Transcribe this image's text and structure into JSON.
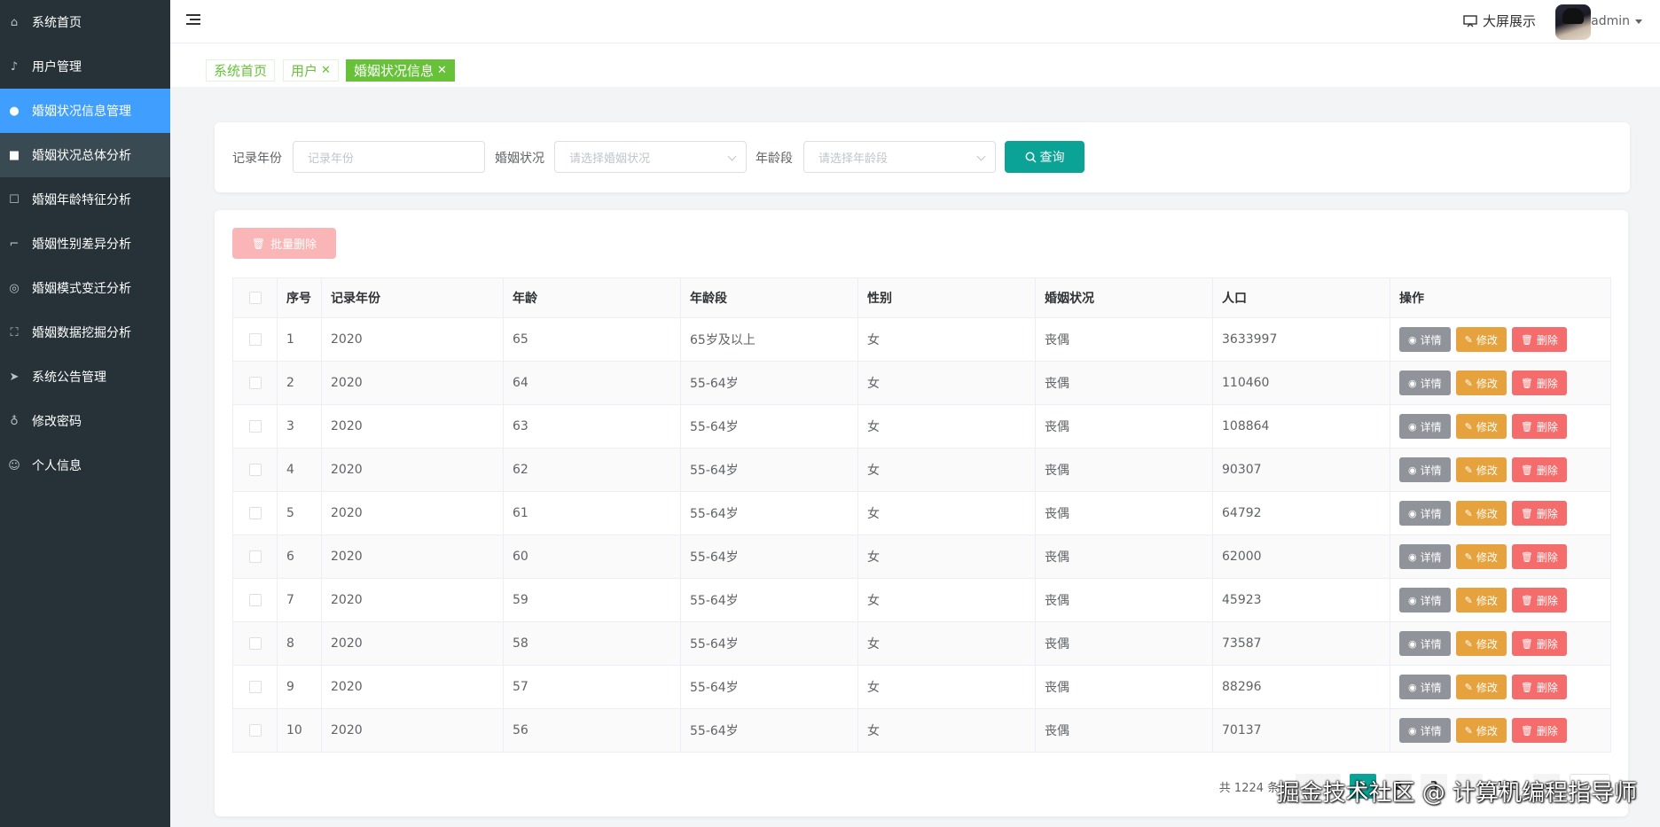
{
  "sidebar": {
    "items": [
      {
        "label": "系统首页",
        "icon": "home-icon",
        "glyph": "⌂"
      },
      {
        "label": "用户管理",
        "icon": "microphone-icon",
        "glyph": "♪"
      },
      {
        "label": "婚姻状况信息管理",
        "icon": "bulb-icon",
        "glyph": "●"
      },
      {
        "label": "婚姻状况总体分析",
        "icon": "briefcase-icon",
        "glyph": "■"
      },
      {
        "label": "婚姻年龄特征分析",
        "icon": "chat-icon",
        "glyph": "☐"
      },
      {
        "label": "婚姻性别差异分析",
        "icon": "crop-icon",
        "glyph": "⌐"
      },
      {
        "label": "婚姻模式变迁分析",
        "icon": "target-icon",
        "glyph": "◎"
      },
      {
        "label": "婚姻数据挖掘分析",
        "icon": "fullscreen-icon",
        "glyph": "⛶"
      },
      {
        "label": "系统公告管理",
        "icon": "send-icon",
        "glyph": "➤"
      },
      {
        "label": "修改密码",
        "icon": "key-icon",
        "glyph": "♁"
      },
      {
        "label": "个人信息",
        "icon": "user-icon",
        "glyph": "☺"
      }
    ]
  },
  "header": {
    "bigscreen_label": "大屏展示",
    "username": "admin"
  },
  "tags": {
    "home": "系统首页",
    "user": "用户",
    "marriage": "婚姻状况信息"
  },
  "search": {
    "year_label": "记录年份",
    "year_placeholder": "记录年份",
    "status_label": "婚姻状况",
    "status_placeholder": "请选择婚姻状况",
    "age_group_label": "年龄段",
    "age_group_placeholder": "请选择年龄段",
    "query_label": "查询"
  },
  "toolbar": {
    "batch_delete_label": "批量删除"
  },
  "table": {
    "headers": [
      "序号",
      "记录年份",
      "年龄",
      "年龄段",
      "性别",
      "婚姻状况",
      "人口",
      "操作"
    ],
    "action_labels": {
      "detail": "详情",
      "edit": "修改",
      "delete": "删除"
    },
    "rows": [
      {
        "index": "1",
        "year": "2020",
        "age": "65",
        "age_group": "65岁及以上",
        "gender": "女",
        "status": "丧偶",
        "population": "3633997"
      },
      {
        "index": "2",
        "year": "2020",
        "age": "64",
        "age_group": "55-64岁",
        "gender": "女",
        "status": "丧偶",
        "population": "110460"
      },
      {
        "index": "3",
        "year": "2020",
        "age": "63",
        "age_group": "55-64岁",
        "gender": "女",
        "status": "丧偶",
        "population": "108864"
      },
      {
        "index": "4",
        "year": "2020",
        "age": "62",
        "age_group": "55-64岁",
        "gender": "女",
        "status": "丧偶",
        "population": "90307"
      },
      {
        "index": "5",
        "year": "2020",
        "age": "61",
        "age_group": "55-64岁",
        "gender": "女",
        "status": "丧偶",
        "population": "64792"
      },
      {
        "index": "6",
        "year": "2020",
        "age": "60",
        "age_group": "55-64岁",
        "gender": "女",
        "status": "丧偶",
        "population": "62000"
      },
      {
        "index": "7",
        "year": "2020",
        "age": "59",
        "age_group": "55-64岁",
        "gender": "女",
        "status": "丧偶",
        "population": "45923"
      },
      {
        "index": "8",
        "year": "2020",
        "age": "58",
        "age_group": "55-64岁",
        "gender": "女",
        "status": "丧偶",
        "population": "73587"
      },
      {
        "index": "9",
        "year": "2020",
        "age": "57",
        "age_group": "55-64岁",
        "gender": "女",
        "status": "丧偶",
        "population": "88296"
      },
      {
        "index": "10",
        "year": "2020",
        "age": "56",
        "age_group": "55-64岁",
        "gender": "女",
        "status": "丧偶",
        "population": "70137"
      }
    ]
  },
  "pagination": {
    "total_text": "共 1224 条",
    "prev_label": "上一页",
    "pages": [
      "1",
      "2",
      "3"
    ],
    "current_page": "1",
    "last_page_fragment": "123"
  },
  "watermark": "掘金技术社区 @ 计算机编程指导师",
  "colors": {
    "sidebar_bg": "#263238",
    "active_menu": "#409eff",
    "primary": "#0aa396",
    "tag_green": "#67c23a",
    "detail": "#909399",
    "edit": "#e6a23c",
    "delete": "#f56c6c"
  }
}
